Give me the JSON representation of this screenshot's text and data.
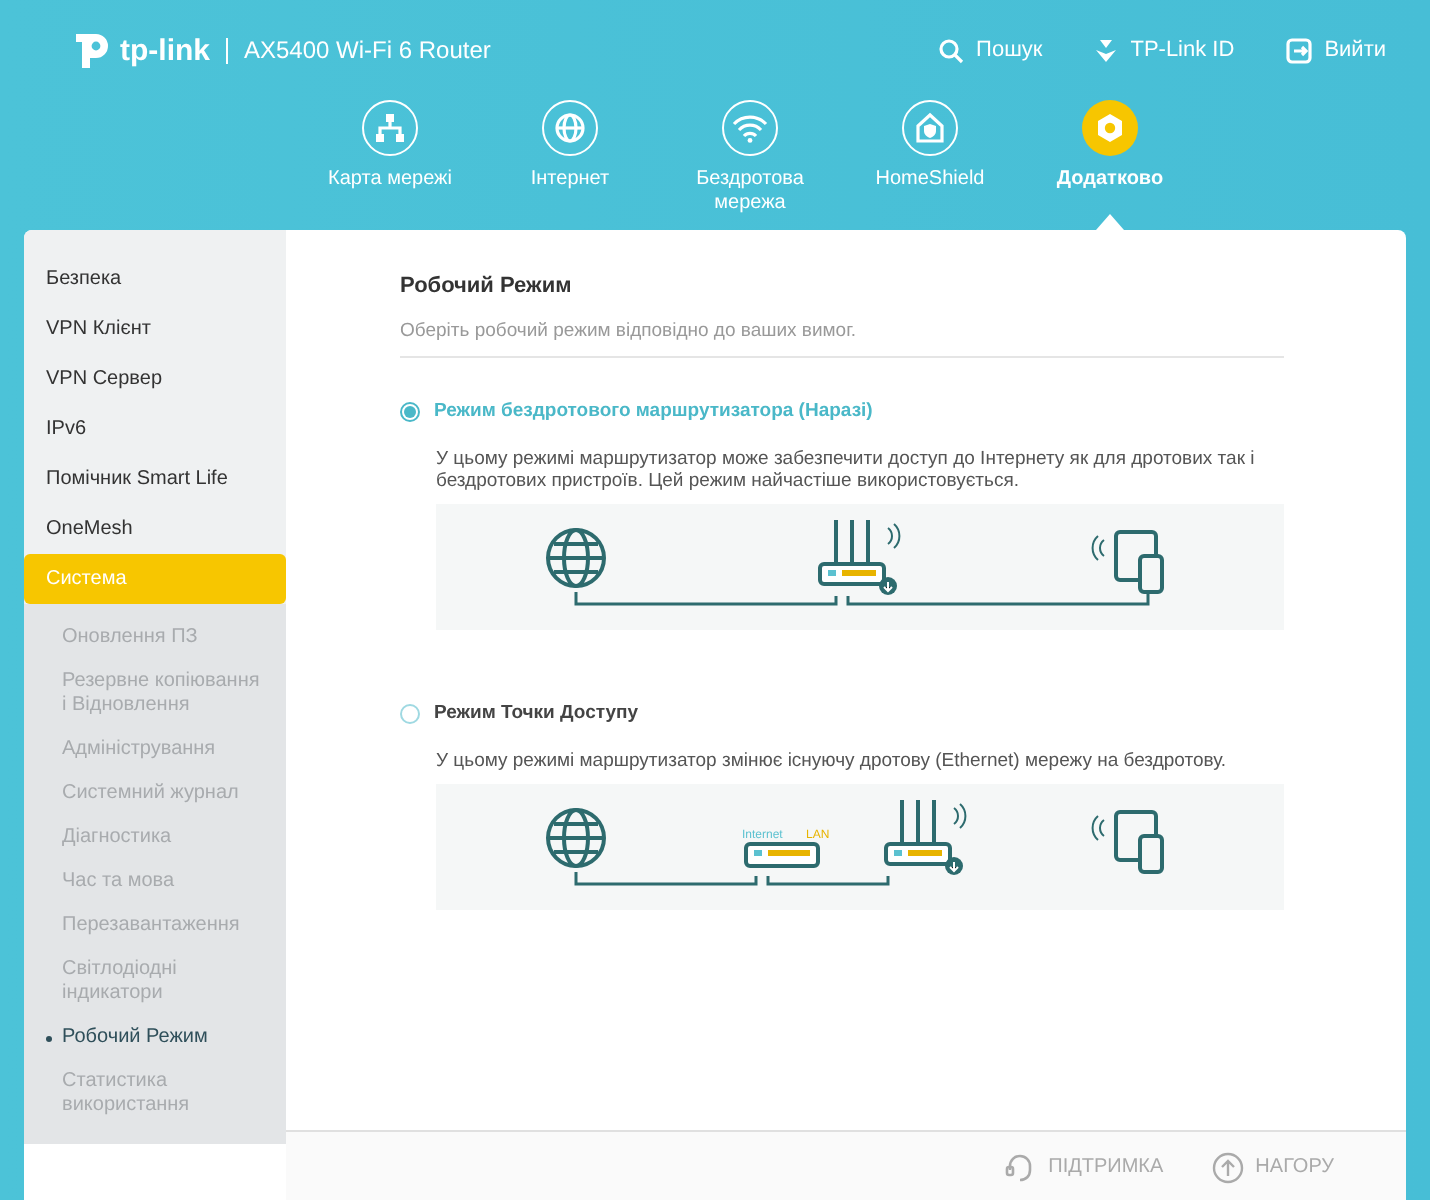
{
  "header": {
    "logo": "tp-link",
    "model": "AX5400 Wi-Fi 6 Router",
    "links": [
      {
        "kind": "search",
        "label": "Пошук"
      },
      {
        "kind": "account",
        "label": "TP-Link ID"
      },
      {
        "kind": "logout",
        "label": "Вийти"
      }
    ]
  },
  "nav": [
    {
      "kind": "map",
      "label": "Карта мережі",
      "selected": false
    },
    {
      "kind": "globe",
      "label": "Інтернет",
      "selected": false
    },
    {
      "kind": "wifi",
      "label": "Бездротова мережа",
      "selected": false
    },
    {
      "kind": "shield",
      "label": "HomeShield",
      "selected": false
    },
    {
      "kind": "gear",
      "label": "Додатково",
      "selected": true
    }
  ],
  "sidebar": {
    "items": [
      {
        "label": "Безпека",
        "selected": false
      },
      {
        "label": "VPN Клієнт",
        "selected": false
      },
      {
        "label": "VPN Сервер",
        "selected": false
      },
      {
        "label": "IPv6",
        "selected": false
      },
      {
        "label": "Помічник Smart Life",
        "selected": false
      },
      {
        "label": "OneMesh",
        "selected": false
      },
      {
        "label": "Система",
        "selected": true,
        "children": [
          {
            "label": "Оновлення ПЗ",
            "selected": false
          },
          {
            "label": "Резервне копіювання і Відновлення",
            "selected": false
          },
          {
            "label": "Адміністрування",
            "selected": false
          },
          {
            "label": "Системний журнал",
            "selected": false
          },
          {
            "label": "Діагностика",
            "selected": false
          },
          {
            "label": "Час та мова",
            "selected": false
          },
          {
            "label": "Перезавантаження",
            "selected": false
          },
          {
            "label": "Світлодіодні індикатори",
            "selected": false
          },
          {
            "label": "Робочий Режим",
            "selected": true
          },
          {
            "label": "Статистика використання",
            "selected": false
          }
        ]
      }
    ]
  },
  "main": {
    "title": "Робочий Режим",
    "subtitle": "Оберіть робочий режим відповідно до ваших вимог.",
    "modes": [
      {
        "kind": "router",
        "label": "Режим бездротового маршрутизатора (Наразі)",
        "selected": true,
        "description": "У цьому режимі маршрутизатор може забезпечити доступ до Інтернету як для дротових так і бездротових пристроїв. Цей режим найчастіше використовується."
      },
      {
        "kind": "access_point",
        "label": "Режим Точки Доступу",
        "selected": false,
        "description": "У цьому режимі маршрутизатор змінює існуючу дротову (Ethernet) мережу на бездротову.",
        "port_labels": [
          "Internet",
          "LAN"
        ]
      }
    ]
  },
  "footer": [
    {
      "kind": "support",
      "label": "ПІДТРИМКА"
    },
    {
      "kind": "up",
      "label": "НАГОРУ"
    }
  ]
}
